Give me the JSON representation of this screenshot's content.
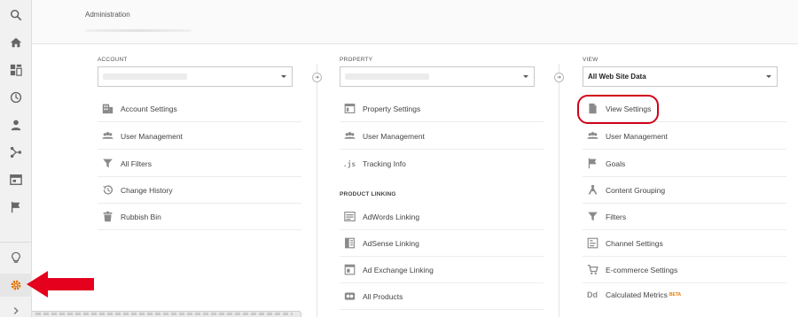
{
  "header": {
    "admin_title": "Administration"
  },
  "account": {
    "label": "ACCOUNT",
    "items": [
      "Account Settings",
      "User Management",
      "All Filters",
      "Change History",
      "Rubbish Bin"
    ]
  },
  "property": {
    "label": "PROPERTY",
    "items": [
      "Property Settings",
      "User Management",
      "Tracking Info"
    ],
    "linking_header": "PRODUCT LINKING",
    "linking_items": [
      "AdWords Linking",
      "AdSense Linking",
      "Ad Exchange Linking",
      "All Products"
    ]
  },
  "view": {
    "label": "VIEW",
    "selected": "All Web Site Data",
    "items": [
      "View Settings",
      "User Management",
      "Goals",
      "Content Grouping",
      "Filters",
      "Channel Settings",
      "E-commerce Settings",
      "Calculated Metrics"
    ],
    "beta_badge": "BETA"
  },
  "colors": {
    "highlight": "#d0021b",
    "active_gear": "#e37400",
    "beta": "#e07b00"
  },
  "icons": {
    "rail": [
      "search-icon",
      "home-icon",
      "customization-icon",
      "realtime-clock-icon",
      "audience-person-icon",
      "acquisition-icon",
      "behavior-icon",
      "conversions-flag-icon",
      "discover-lightbulb-icon",
      "admin-gear-icon"
    ]
  }
}
